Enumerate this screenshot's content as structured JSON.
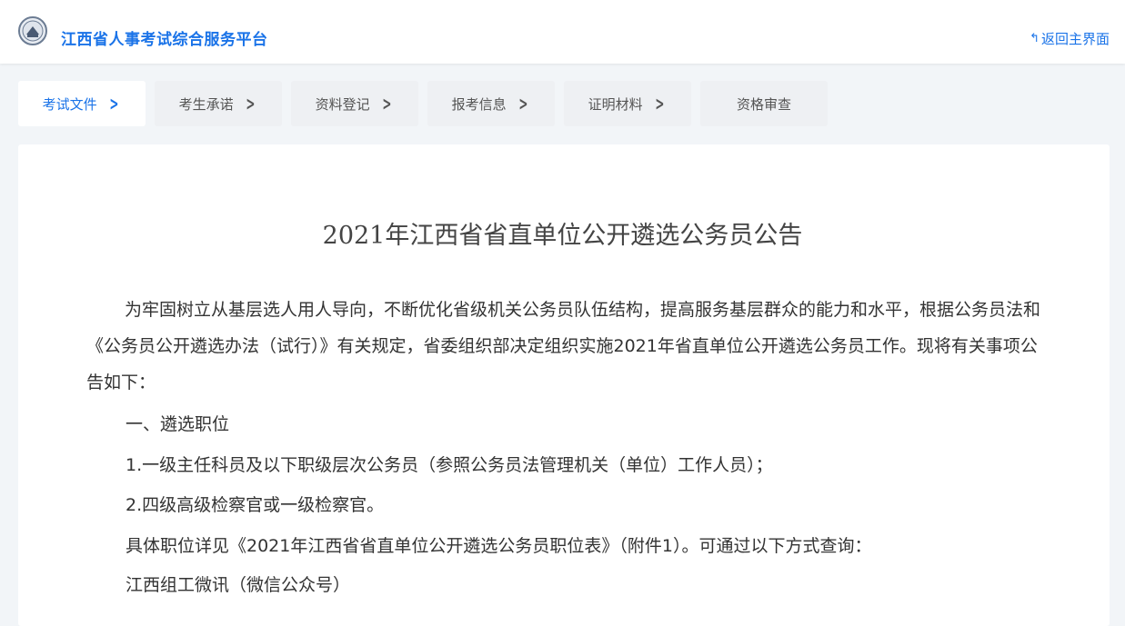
{
  "header": {
    "site_title": "江西省人事考试综合服务平台",
    "back_label": "返回主界面",
    "back_icon": "reply-arrow-icon"
  },
  "steps": [
    {
      "label": "考试文件",
      "active": true
    },
    {
      "label": "考生承诺",
      "active": false
    },
    {
      "label": "资料登记",
      "active": false
    },
    {
      "label": "报考信息",
      "active": false
    },
    {
      "label": "证明材料",
      "active": false
    },
    {
      "label": "资格审查",
      "active": false
    }
  ],
  "document": {
    "title": "2021年江西省省直单位公开遴选公务员公告",
    "intro": "为牢固树立从基层选人用人导向，不断优化省级机关公务员队伍结构，提高服务基层群众的能力和水平，根据公务员法和《公务员公开遴选办法（试行）》有关规定，省委组织部决定组织实施2021年省直单位公开遴选公务员工作。现将有关事项公告如下：",
    "section1_heading": "一、遴选职位",
    "item1": "1.一级主任科员及以下职级层次公务员（参照公务员法管理机关（单位）工作人员）；",
    "item2": "2.四级高级检察官或一级检察官。",
    "detail": "具体职位详见《2021年江西省省直单位公开遴选公务员职位表》（附件1）。可通过以下方式查询：",
    "channel1": "江西组工微讯（微信公众号）"
  },
  "colors": {
    "accent": "#1a73e8",
    "page_bg": "#f2f5f8"
  }
}
